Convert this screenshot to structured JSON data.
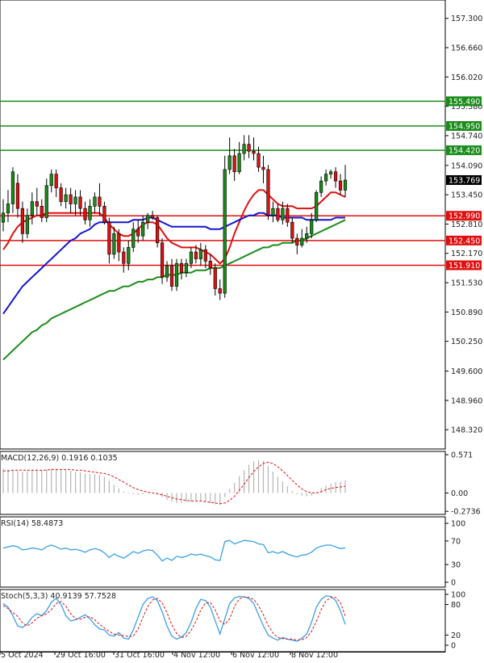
{
  "chart_data": [
    {
      "type": "candlestick",
      "title": "",
      "ylim": [
        147.9,
        157.7
      ],
      "y_ticks": [
        "157.300",
        "156.660",
        "156.020",
        "155.380",
        "154.740",
        "154.090",
        "153.450",
        "152.810",
        "152.170",
        "151.530",
        "150.890",
        "150.250",
        "149.600",
        "148.960",
        "148.320"
      ],
      "current_price": "153.769",
      "horizontal_levels": [
        {
          "label": "155.490",
          "value": 155.49,
          "color": "#1a8c1a"
        },
        {
          "label": "154.950",
          "value": 154.95,
          "color": "#1a8c1a"
        },
        {
          "label": "154.420",
          "value": 154.42,
          "color": "#1a8c1a"
        },
        {
          "label": "152.990",
          "value": 152.99,
          "color": "#e01010"
        },
        {
          "label": "152.450",
          "value": 152.45,
          "color": "#e01010"
        },
        {
          "label": "151.910",
          "value": 151.91,
          "color": "#e01010"
        }
      ],
      "candles": [
        [
          152.85,
          153.05,
          153.35,
          152.65
        ],
        [
          153.05,
          153.25,
          153.55,
          152.85
        ],
        [
          153.25,
          153.95,
          154.05,
          153.05
        ],
        [
          153.7,
          153.15,
          153.9,
          152.95
        ],
        [
          153.15,
          152.6,
          153.3,
          152.4
        ],
        [
          152.6,
          153.0,
          153.15,
          152.5
        ],
        [
          153.0,
          153.3,
          153.5,
          152.8
        ],
        [
          153.3,
          153.2,
          153.6,
          153.0
        ],
        [
          153.2,
          152.95,
          153.35,
          152.85
        ],
        [
          152.95,
          153.65,
          153.8,
          152.85
        ],
        [
          153.65,
          153.9,
          154.0,
          153.5
        ],
        [
          153.9,
          153.6,
          154.0,
          153.4
        ],
        [
          153.6,
          153.3,
          153.7,
          153.2
        ],
        [
          153.3,
          153.45,
          153.6,
          153.15
        ],
        [
          153.45,
          153.25,
          153.6,
          153.05
        ],
        [
          153.25,
          153.4,
          153.55,
          153.0
        ],
        [
          153.4,
          153.15,
          153.55,
          153.0
        ],
        [
          153.15,
          152.9,
          153.3,
          152.8
        ],
        [
          152.9,
          153.2,
          153.35,
          152.75
        ],
        [
          153.2,
          153.4,
          153.5,
          153.05
        ],
        [
          153.4,
          153.2,
          153.7,
          153.0
        ],
        [
          153.2,
          152.85,
          153.3,
          152.8
        ],
        [
          152.85,
          152.15,
          152.95,
          151.95
        ],
        [
          152.15,
          152.6,
          152.75,
          152.05
        ],
        [
          152.6,
          152.2,
          152.7,
          152.0
        ],
        [
          152.2,
          151.95,
          152.3,
          151.75
        ],
        [
          151.95,
          152.3,
          152.45,
          151.8
        ],
        [
          152.3,
          152.7,
          152.85,
          152.2
        ],
        [
          152.7,
          152.55,
          152.9,
          152.4
        ],
        [
          152.55,
          152.85,
          153.0,
          152.45
        ],
        [
          152.85,
          153.0,
          153.05,
          152.7
        ],
        [
          153.0,
          152.95,
          153.1,
          152.9
        ],
        [
          152.95,
          152.4,
          153.0,
          152.3
        ],
        [
          152.4,
          151.65,
          152.5,
          151.5
        ],
        [
          151.65,
          151.9,
          152.0,
          151.55
        ],
        [
          151.9,
          151.45,
          152.05,
          151.35
        ],
        [
          151.45,
          151.95,
          152.05,
          151.35
        ],
        [
          151.95,
          151.75,
          152.05,
          151.6
        ],
        [
          151.75,
          151.95,
          152.05,
          151.65
        ],
        [
          151.95,
          152.2,
          152.3,
          151.85
        ],
        [
          152.2,
          152.05,
          152.35,
          151.95
        ],
        [
          152.05,
          152.25,
          152.4,
          151.9
        ],
        [
          152.25,
          152.0,
          152.35,
          151.85
        ],
        [
          152.0,
          151.85,
          152.15,
          151.7
        ],
        [
          151.85,
          151.4,
          151.95,
          151.25
        ],
        [
          151.4,
          151.3,
          151.6,
          151.15
        ],
        [
          151.3,
          154.0,
          154.3,
          151.2
        ],
        [
          154.0,
          154.3,
          154.7,
          153.9
        ],
        [
          154.3,
          153.95,
          154.45,
          153.75
        ],
        [
          153.95,
          154.35,
          154.6,
          153.9
        ],
        [
          154.35,
          154.55,
          154.75,
          154.2
        ],
        [
          154.55,
          154.4,
          154.75,
          154.25
        ],
        [
          154.4,
          154.35,
          154.7,
          154.2
        ],
        [
          154.35,
          154.05,
          154.5,
          153.95
        ],
        [
          154.05,
          154.0,
          154.3,
          153.7
        ],
        [
          154.0,
          153.0,
          154.1,
          152.9
        ],
        [
          153.0,
          153.15,
          153.3,
          152.85
        ],
        [
          153.15,
          152.9,
          153.25,
          152.85
        ],
        [
          152.9,
          153.15,
          153.3,
          152.8
        ],
        [
          153.15,
          152.85,
          153.25,
          152.75
        ],
        [
          152.85,
          152.5,
          152.95,
          152.4
        ],
        [
          152.5,
          152.35,
          152.6,
          152.15
        ],
        [
          152.35,
          152.5,
          152.7,
          152.3
        ],
        [
          152.5,
          152.6,
          152.75,
          152.4
        ],
        [
          152.6,
          152.9,
          153.05,
          152.5
        ],
        [
          152.9,
          153.5,
          153.55,
          152.85
        ],
        [
          153.5,
          153.75,
          153.85,
          153.4
        ],
        [
          153.75,
          153.9,
          154.0,
          153.65
        ],
        [
          153.9,
          153.95,
          154.0,
          153.8
        ],
        [
          153.95,
          153.75,
          154.05,
          153.6
        ],
        [
          153.75,
          153.55,
          153.9,
          153.45
        ],
        [
          153.55,
          153.77,
          154.1,
          153.4
        ]
      ],
      "ma_series": [
        {
          "color": "#e01010",
          "values": [
            152.25,
            152.4,
            152.6,
            152.75,
            152.85,
            152.9,
            152.95,
            153.0,
            153.0,
            153.05,
            153.05,
            153.05,
            153.05,
            153.05,
            153.05,
            153.05,
            153.05,
            153.05,
            153.05,
            153.05,
            153.05,
            152.95,
            152.8,
            152.7,
            152.6,
            152.55,
            152.55,
            152.6,
            152.7,
            152.8,
            152.85,
            152.85,
            152.8,
            152.65,
            152.5,
            152.4,
            152.35,
            152.3,
            152.3,
            152.3,
            152.3,
            152.25,
            152.2,
            152.15,
            152.05,
            151.95,
            152.05,
            152.3,
            152.6,
            152.85,
            153.1,
            153.3,
            153.45,
            153.55,
            153.55,
            153.45,
            153.35,
            153.25,
            153.2,
            153.2,
            153.2,
            153.15,
            153.15,
            153.15,
            153.15,
            153.2,
            153.3,
            153.4,
            153.5,
            153.5,
            153.45,
            153.4
          ]
        },
        {
          "color": "#1515d0",
          "values": [
            150.85,
            151.0,
            151.15,
            151.3,
            151.45,
            151.55,
            151.65,
            151.75,
            151.85,
            151.95,
            152.05,
            152.15,
            152.25,
            152.35,
            152.45,
            152.5,
            152.6,
            152.65,
            152.7,
            152.8,
            152.85,
            152.85,
            152.85,
            152.85,
            152.85,
            152.85,
            152.85,
            152.9,
            152.9,
            152.9,
            152.95,
            152.95,
            152.9,
            152.85,
            152.8,
            152.75,
            152.75,
            152.75,
            152.75,
            152.75,
            152.75,
            152.75,
            152.75,
            152.7,
            152.7,
            152.7,
            152.75,
            152.8,
            152.85,
            152.9,
            152.95,
            153.0,
            153.0,
            153.05,
            153.05,
            153.0,
            153.0,
            153.0,
            152.95,
            152.95,
            152.95,
            152.95,
            152.95,
            152.9,
            152.9,
            152.9,
            152.9,
            152.9,
            152.9,
            152.95,
            152.95,
            152.95
          ]
        },
        {
          "color": "#1a8c1a",
          "values": [
            149.85,
            149.95,
            150.05,
            150.15,
            150.25,
            150.35,
            150.45,
            150.5,
            150.6,
            150.65,
            150.75,
            150.8,
            150.85,
            150.9,
            150.95,
            151.0,
            151.05,
            151.1,
            151.15,
            151.2,
            151.25,
            151.3,
            151.35,
            151.35,
            151.4,
            151.45,
            151.45,
            151.5,
            151.55,
            151.55,
            151.6,
            151.6,
            151.65,
            151.65,
            151.7,
            151.7,
            151.7,
            151.75,
            151.75,
            151.75,
            151.8,
            151.8,
            151.8,
            151.85,
            151.85,
            151.85,
            151.9,
            151.95,
            152.0,
            152.05,
            152.1,
            152.15,
            152.2,
            152.25,
            152.3,
            152.3,
            152.35,
            152.35,
            152.4,
            152.4,
            152.4,
            152.45,
            152.45,
            152.5,
            152.55,
            152.6,
            152.65,
            152.7,
            152.75,
            152.8,
            152.85,
            152.9
          ]
        }
      ],
      "time_labels": [
        "5 Oct 2024",
        "29 Oct 16:00",
        "31 Oct 16:00",
        "4 Nov 12:00",
        "6 Nov 12:00",
        "8 Nov 12:00"
      ]
    },
    {
      "type": "bar",
      "label": "MACD(12,26,9) 0.1916 0.1035",
      "ylim": [
        -0.32,
        0.62
      ],
      "y_ticks": [
        "0.571",
        "0.00",
        "-0.2736"
      ],
      "histogram": [
        0.36,
        0.35,
        0.34,
        0.33,
        0.32,
        0.33,
        0.34,
        0.34,
        0.34,
        0.35,
        0.36,
        0.36,
        0.35,
        0.34,
        0.33,
        0.32,
        0.31,
        0.29,
        0.28,
        0.28,
        0.27,
        0.24,
        0.18,
        0.12,
        0.07,
        0.02,
        -0.01,
        -0.02,
        -0.03,
        -0.02,
        -0.01,
        0.0,
        -0.02,
        -0.06,
        -0.1,
        -0.13,
        -0.15,
        -0.15,
        -0.14,
        -0.13,
        -0.12,
        -0.12,
        -0.13,
        -0.15,
        -0.17,
        -0.18,
        -0.06,
        0.06,
        0.15,
        0.25,
        0.34,
        0.42,
        0.47,
        0.49,
        0.48,
        0.4,
        0.32,
        0.24,
        0.17,
        0.1,
        0.03,
        -0.02,
        -0.04,
        -0.05,
        -0.04,
        0.01,
        0.07,
        0.11,
        0.14,
        0.16,
        0.17,
        0.19
      ],
      "signal_color": "#e01010",
      "signal": [
        0.33,
        0.33,
        0.34,
        0.34,
        0.34,
        0.34,
        0.34,
        0.34,
        0.34,
        0.34,
        0.35,
        0.35,
        0.35,
        0.35,
        0.35,
        0.34,
        0.34,
        0.33,
        0.32,
        0.31,
        0.3,
        0.29,
        0.27,
        0.24,
        0.2,
        0.16,
        0.12,
        0.08,
        0.05,
        0.03,
        0.01,
        0.0,
        -0.01,
        -0.03,
        -0.05,
        -0.07,
        -0.09,
        -0.1,
        -0.11,
        -0.12,
        -0.12,
        -0.12,
        -0.13,
        -0.14,
        -0.15,
        -0.16,
        -0.15,
        -0.11,
        -0.05,
        0.04,
        0.13,
        0.23,
        0.32,
        0.39,
        0.44,
        0.46,
        0.44,
        0.39,
        0.33,
        0.26,
        0.19,
        0.12,
        0.06,
        0.02,
        0.0,
        0.0,
        0.02,
        0.05,
        0.07,
        0.08,
        0.09,
        0.1
      ]
    },
    {
      "type": "line",
      "label": "RSI(14) 58.4873",
      "ylim": [
        0,
        100
      ],
      "y_ticks": [
        "100",
        "70",
        "30",
        "0"
      ],
      "line_color": "#3aa0e8",
      "values": [
        58,
        60,
        62,
        60,
        55,
        56,
        58,
        57,
        55,
        60,
        63,
        60,
        56,
        58,
        55,
        56,
        54,
        51,
        55,
        57,
        55,
        50,
        42,
        48,
        44,
        41,
        46,
        52,
        49,
        53,
        55,
        54,
        46,
        36,
        41,
        37,
        44,
        42,
        44,
        48,
        46,
        48,
        45,
        43,
        38,
        37,
        69,
        71,
        65,
        68,
        71,
        70,
        69,
        65,
        64,
        50,
        52,
        49,
        52,
        48,
        45,
        43,
        46,
        47,
        51,
        58,
        61,
        63,
        63,
        60,
        57,
        58.49
      ]
    },
    {
      "type": "line",
      "label": "Stoch(5,3,3) 40.9139 57.7528",
      "ylim": [
        0,
        100
      ],
      "y_ticks": [
        "100",
        "80",
        "20",
        "0"
      ],
      "main_color": "#3aa0e8",
      "signal_color": "#e01010",
      "main": [
        82,
        75,
        58,
        38,
        35,
        42,
        55,
        62,
        58,
        68,
        85,
        92,
        80,
        58,
        48,
        50,
        55,
        60,
        52,
        40,
        32,
        30,
        20,
        18,
        25,
        14,
        12,
        30,
        55,
        80,
        92,
        95,
        88,
        65,
        38,
        18,
        12,
        16,
        25,
        45,
        72,
        90,
        88,
        75,
        48,
        22,
        52,
        82,
        93,
        96,
        95,
        92,
        82,
        60,
        38,
        20,
        14,
        10,
        15,
        12,
        10,
        8,
        14,
        22,
        45,
        75,
        90,
        97,
        96,
        88,
        68,
        40.91
      ],
      "signal": [
        78,
        72,
        64,
        57,
        44,
        38,
        44,
        53,
        58,
        62,
        70,
        82,
        86,
        77,
        62,
        52,
        51,
        55,
        56,
        50,
        41,
        34,
        27,
        22,
        20,
        19,
        17,
        18,
        32,
        55,
        76,
        89,
        92,
        83,
        64,
        40,
        23,
        15,
        18,
        29,
        47,
        69,
        83,
        84,
        70,
        48,
        41,
        52,
        76,
        91,
        95,
        94,
        90,
        78,
        60,
        39,
        24,
        15,
        13,
        12,
        12,
        10,
        11,
        15,
        27,
        47,
        70,
        87,
        94,
        94,
        84,
        57.75
      ]
    }
  ]
}
